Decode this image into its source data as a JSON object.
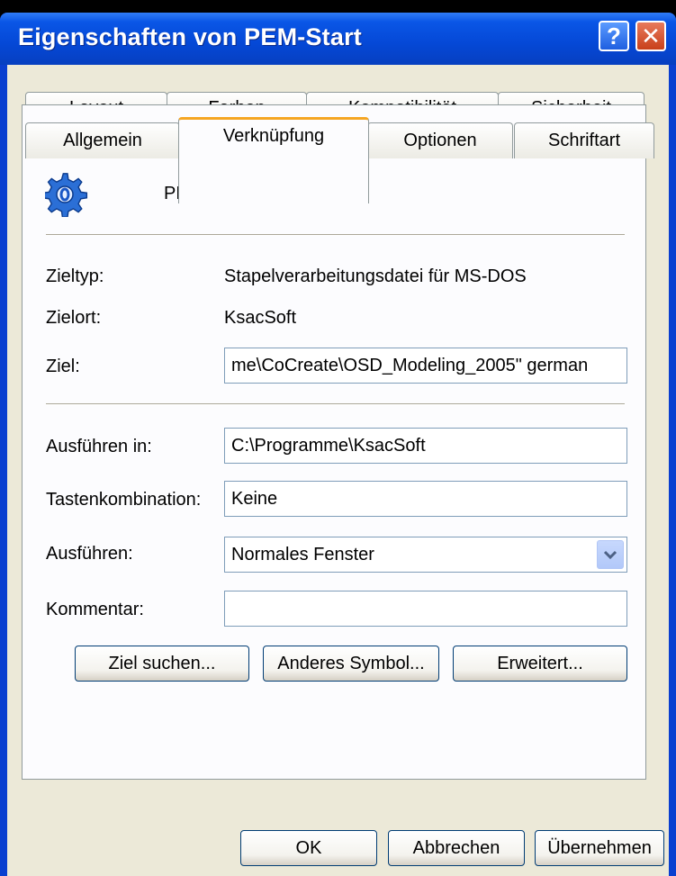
{
  "window": {
    "title": "Eigenschaften von PEM-Start"
  },
  "titlebar_buttons": {
    "help": "?",
    "close": "✕"
  },
  "tabs_row1": [
    "Layout",
    "Farben",
    "Kompatibilität",
    "Sicherheit"
  ],
  "tabs_row2": [
    "Allgemein",
    "Verknüpfung",
    "Optionen",
    "Schriftart"
  ],
  "shortcut": {
    "name": "PEM-Start",
    "icon": "gear-batch-icon"
  },
  "info": {
    "zieltyp_label": "Zieltyp:",
    "zieltyp_value": "Stapelverarbeitungsdatei für MS-DOS",
    "zielort_label": "Zielort:",
    "zielort_value": "KsacSoft",
    "ziel_label": "Ziel:",
    "ziel_value": "me\\CoCreate\\OSD_Modeling_2005\" german"
  },
  "form": {
    "ausfuehren_in_label": "Ausführen in:",
    "ausfuehren_in_value": "C:\\Programme\\KsacSoft",
    "tastenkombination_label": "Tastenkombination:",
    "tastenkombination_value": "Keine",
    "ausfuehren_label": "Ausführen:",
    "ausfuehren_value": "Normales Fenster",
    "kommentar_label": "Kommentar:",
    "kommentar_value": ""
  },
  "actions": {
    "ziel_suchen": "Ziel suchen...",
    "anderes_symbol": "Anderes Symbol...",
    "erweitert": "Erweitert..."
  },
  "dialog_buttons": {
    "ok": "OK",
    "abbrechen": "Abbrechen",
    "uebernehmen": "Übernehmen"
  },
  "colors": {
    "titlebar": "#0548d6",
    "accent_tab": "#f5a623",
    "client_bg": "#ece9d8",
    "panel_bg": "#fcfcfe"
  }
}
